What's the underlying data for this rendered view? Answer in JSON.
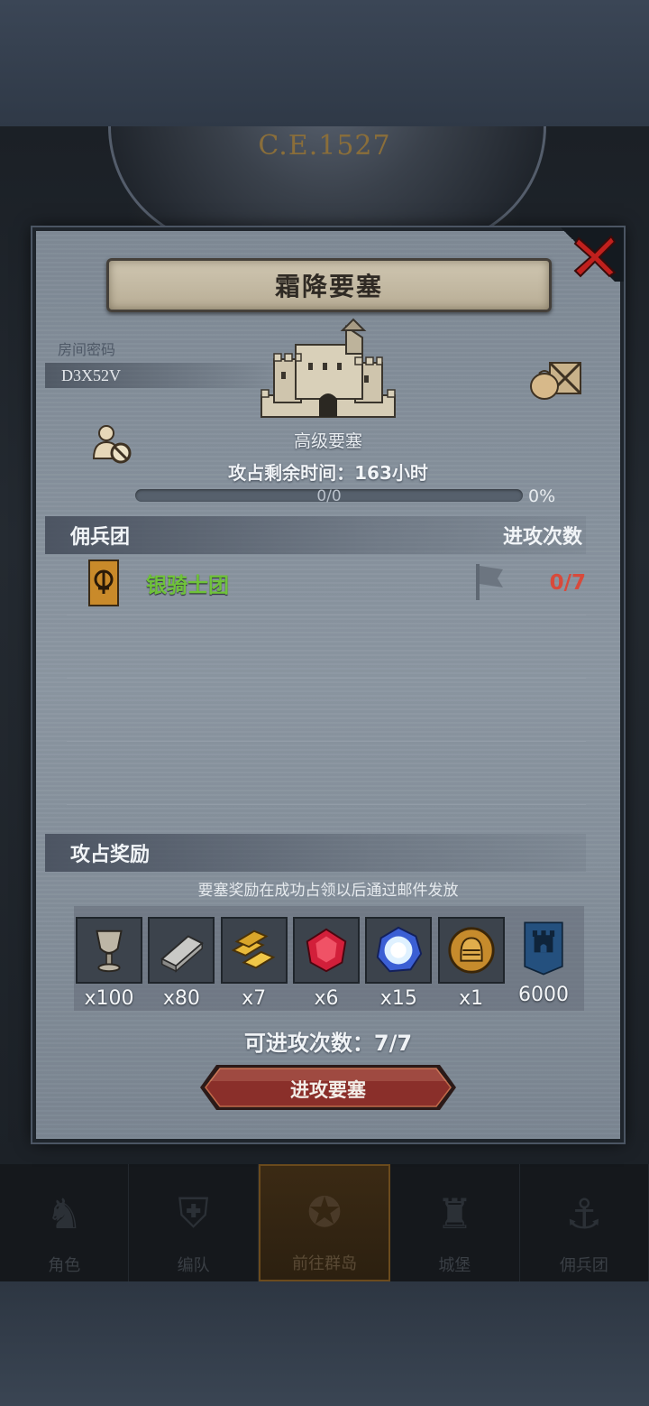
{
  "background": {
    "era_label": "C.E.1527"
  },
  "modal": {
    "title": "霜降要塞",
    "room_label": "房间密码",
    "room_code": "D3X52V",
    "fort_type": "高级要塞",
    "time_left": "攻占剩余时间：163小时",
    "progress": {
      "text": "0/0",
      "percent_label": "0%",
      "fraction": 0
    },
    "mercenary_section": {
      "title": "佣兵团",
      "attack_count_header": "进攻次数",
      "rows": [
        {
          "name": "银骑士团",
          "count": "0/7"
        }
      ]
    },
    "reward_section": {
      "title": "攻占奖励",
      "note": "要塞奖励在成功占领以后通过邮件发放",
      "items": [
        {
          "icon": "goblet-icon",
          "qty": "x100"
        },
        {
          "icon": "iron-ingot-icon",
          "qty": "x80"
        },
        {
          "icon": "gold-bars-icon",
          "qty": "x7"
        },
        {
          "icon": "ruby-gem-icon",
          "qty": "x6"
        },
        {
          "icon": "crystal-orb-icon",
          "qty": "x15"
        },
        {
          "icon": "knight-helmet-medal-icon",
          "qty": "x1"
        },
        {
          "icon": "fortress-banner-icon",
          "qty": "6000"
        }
      ]
    },
    "attacks_available": "可进攻次数：7/7",
    "attack_button": "进攻要塞"
  },
  "nav": {
    "items": [
      {
        "label": "角色",
        "icon": "knight-icon",
        "active": false
      },
      {
        "label": "编队",
        "icon": "armor-icon",
        "active": false
      },
      {
        "label": "前往群岛",
        "icon": "compass-map-icon",
        "active": true
      },
      {
        "label": "城堡",
        "icon": "castle-icon",
        "active": false
      },
      {
        "label": "佣兵团",
        "icon": "ship-icon",
        "active": false
      }
    ]
  },
  "colors": {
    "accent_gold": "#c98a2a",
    "merc_name": "#6fc23a",
    "count_red": "#d84a3b",
    "button_red": "#8a2f2a"
  }
}
